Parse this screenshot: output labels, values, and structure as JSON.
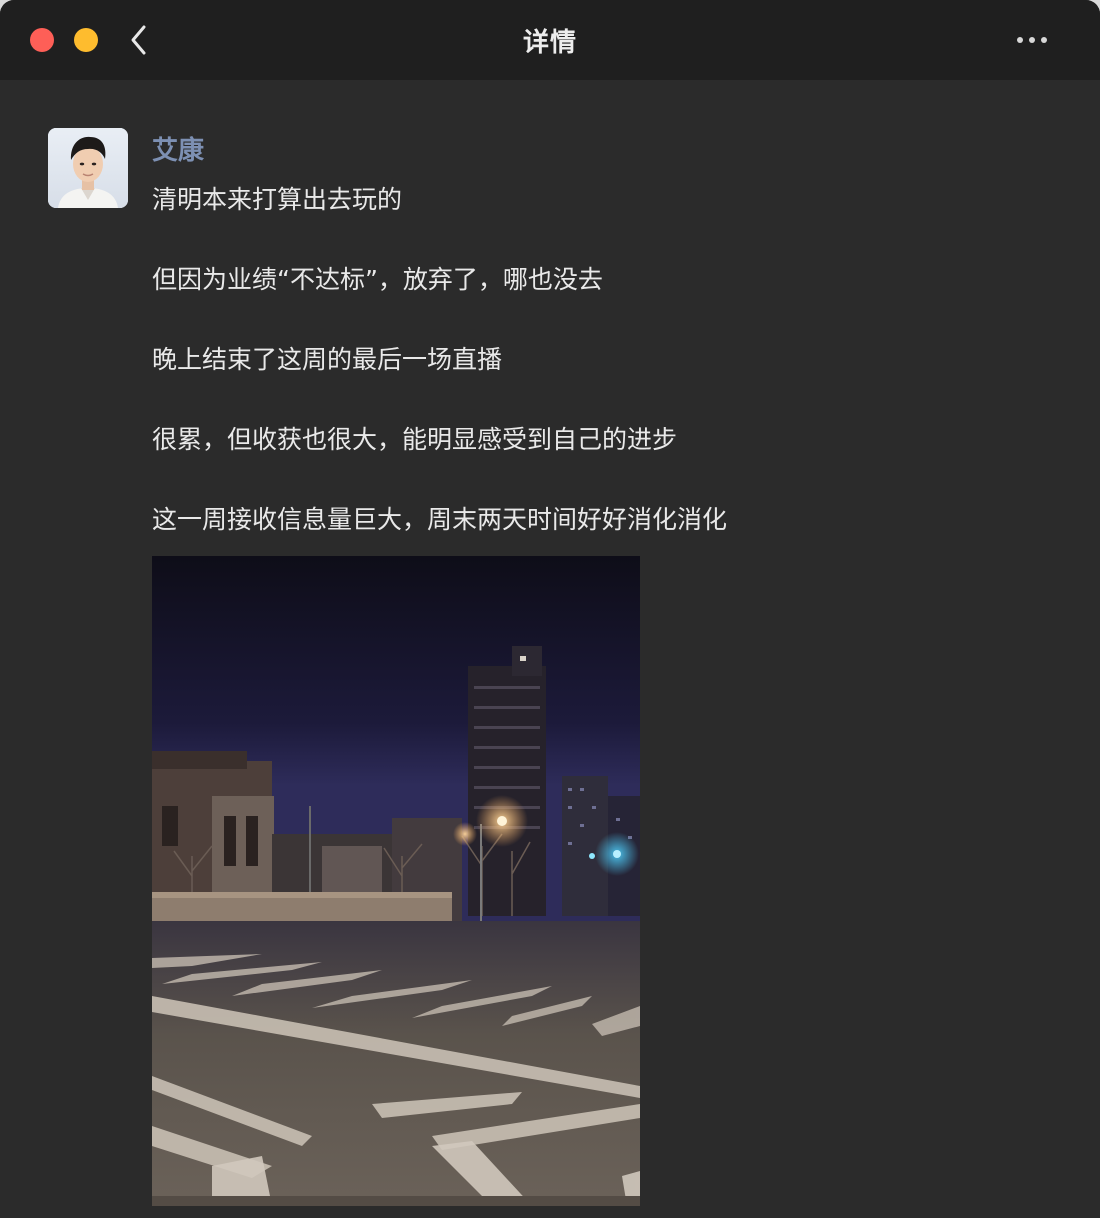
{
  "window": {
    "title": "详情"
  },
  "icons": {
    "back": "chevron-left-icon",
    "more": "ellipsis-icon"
  },
  "colors": {
    "close": "#fe5f57",
    "minimize": "#febc2e",
    "author_name": "#7d90b3",
    "background": "#2b2b2b",
    "titlebar": "#1f1f1f"
  },
  "post": {
    "author": "艾康",
    "lines": [
      "清明本来打算出去玩的",
      "但因为业绩“不达标”，放弃了，哪也没去",
      "晚上结束了这周的最后一场直播",
      "很累，但收获也很大，能明显感受到自己的进步",
      "这一周接收信息量巨大，周末两天时间好好消化消化"
    ]
  }
}
